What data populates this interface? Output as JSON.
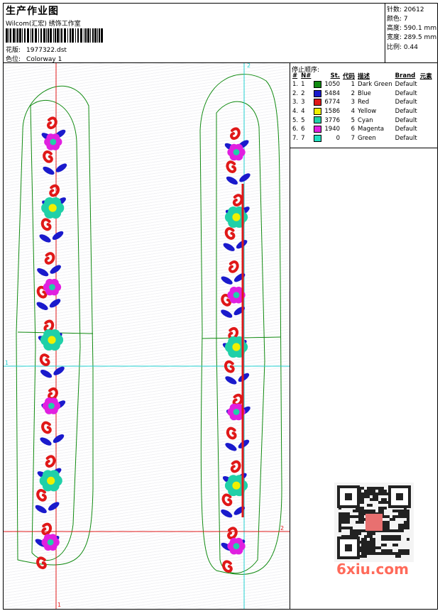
{
  "header": {
    "title": "生产作业图",
    "company": "Wilcom(汇宏) 绣饰工作室",
    "design_label": "花版:",
    "design_value": "1977322.dst",
    "colorway_label": "色位:",
    "colorway_value": "Colorway 1"
  },
  "stats": [
    {
      "label": "针数:",
      "value": "20612"
    },
    {
      "label": "颜色:",
      "value": "7"
    },
    {
      "label": "高度:",
      "value": "590.1 mm"
    },
    {
      "label": "宽度:",
      "value": "289.5 mm"
    },
    {
      "label": "比例:",
      "value": "0.44"
    }
  ],
  "stop_sequence": {
    "title": "停止顺序:",
    "headers": [
      "#",
      "N#",
      "St.",
      "代码",
      "描述",
      "Brand",
      "元素"
    ],
    "rows": [
      {
        "idx": "1.",
        "n": "1",
        "color": "#108a10",
        "st": "1050",
        "code": "1",
        "desc": "Dark Green",
        "brand": "Default"
      },
      {
        "idx": "2.",
        "n": "2",
        "color": "#1a1acc",
        "st": "5484",
        "code": "2",
        "desc": "Blue",
        "brand": "Default"
      },
      {
        "idx": "3.",
        "n": "3",
        "color": "#e01818",
        "st": "6774",
        "code": "3",
        "desc": "Red",
        "brand": "Default"
      },
      {
        "idx": "4.",
        "n": "4",
        "color": "#f0f000",
        "st": "1586",
        "code": "4",
        "desc": "Yellow",
        "brand": "Default"
      },
      {
        "idx": "5.",
        "n": "5",
        "color": "#20d0a8",
        "st": "3776",
        "code": "5",
        "desc": "Cyan",
        "brand": "Default"
      },
      {
        "idx": "6.",
        "n": "6",
        "color": "#e020e0",
        "st": "1940",
        "code": "6",
        "desc": "Magenta",
        "brand": "Default"
      },
      {
        "idx": "7.",
        "n": "7",
        "color": "#20e0c0",
        "st": "0",
        "code": "7",
        "desc": "Green",
        "brand": "Default"
      }
    ]
  },
  "guides": {
    "v1": "1",
    "v2": "2",
    "h1": "1",
    "h2": "2"
  },
  "watermark": "6xiu.com",
  "colors": {
    "blue": "#1a1acc",
    "red": "#e01818",
    "magenta": "#e020e0",
    "cyan": "#20d0a8",
    "yellow": "#f0f000",
    "outline": "#108a10"
  }
}
